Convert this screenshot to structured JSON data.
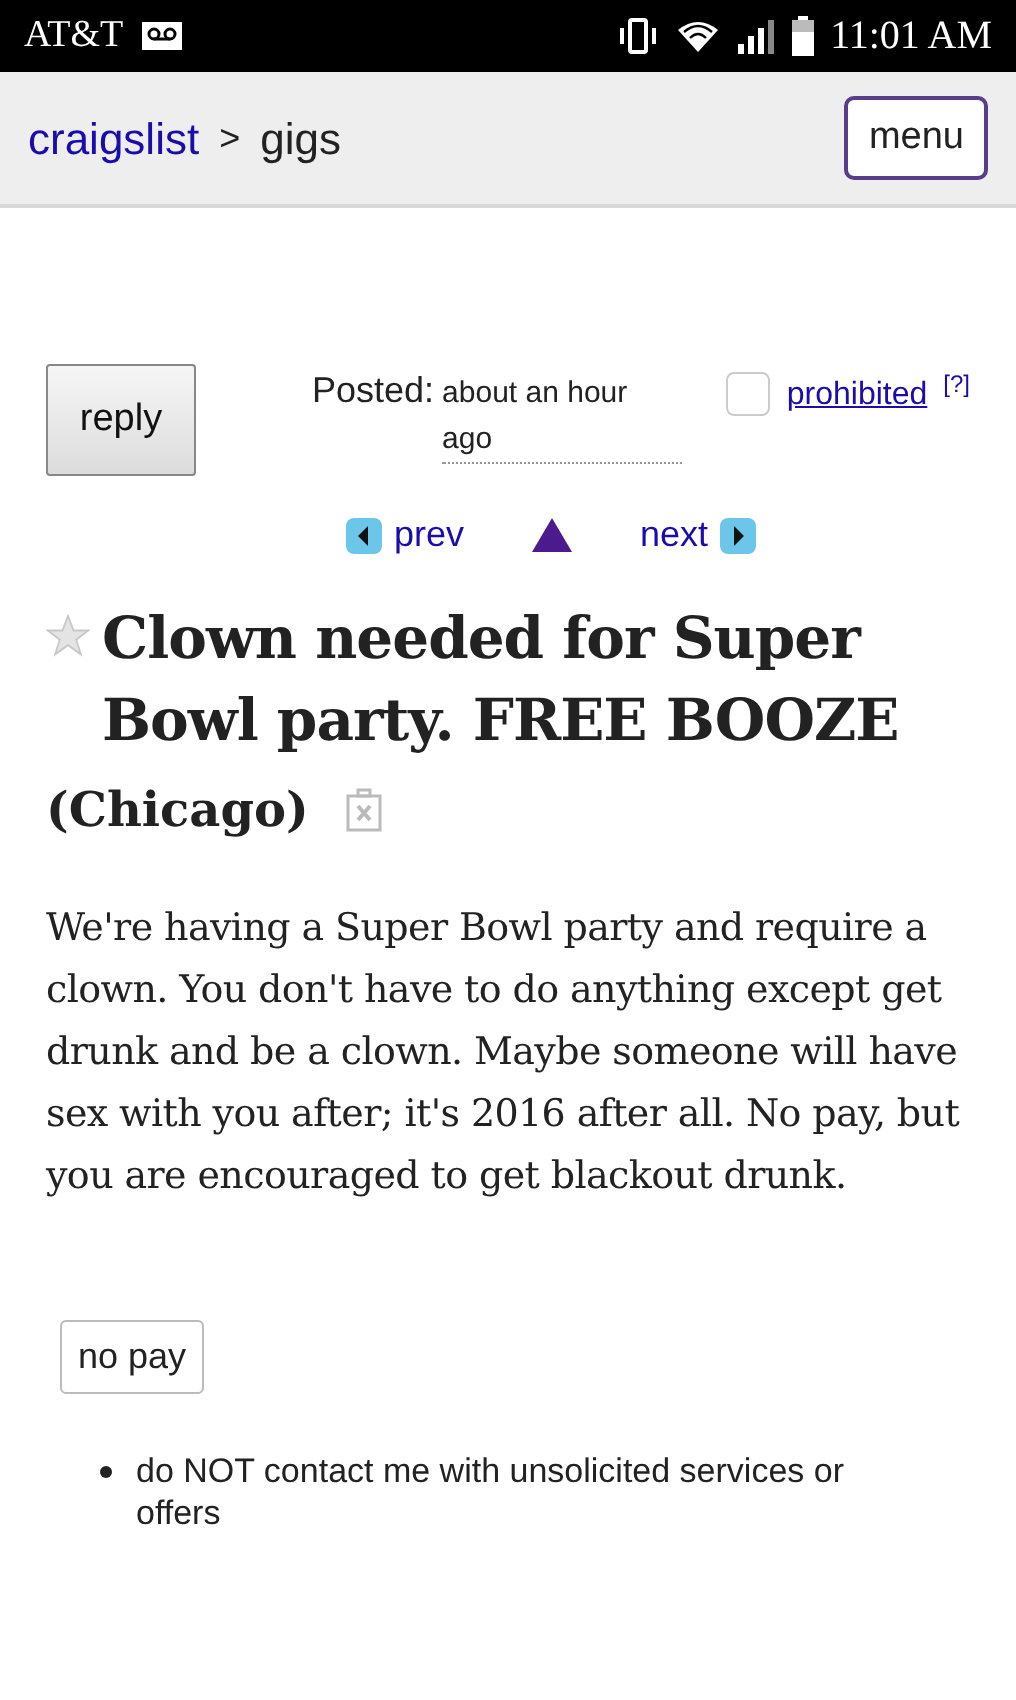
{
  "status_bar": {
    "carrier": "AT&T",
    "time": "11:01 AM"
  },
  "header": {
    "breadcrumb": [
      {
        "label": "craigslist",
        "kind": "link"
      },
      {
        "label": ">",
        "kind": "separator"
      },
      {
        "label": "gigs",
        "kind": "text"
      }
    ],
    "menu_button": "menu"
  },
  "actions": {
    "reply_button": "reply",
    "posted_label": "Posted:",
    "posted_time": "about an hour ago",
    "prohibited": {
      "label": "prohibited",
      "checked": false,
      "help": "[?]"
    }
  },
  "nav": {
    "prev": "prev",
    "next": "next"
  },
  "post": {
    "favorite": false,
    "title": "Clown needed for Super Bowl party. FREE BOOZE",
    "location": "(Chicago)",
    "body": "We're having a Super Bowl party and require a clown. You don't have to do anything except get drunk and be a clown. Maybe someone will have sex with you after; it's 2016 after all. No pay, but you are encouraged to get blackout drunk."
  },
  "compensation": "no pay",
  "notices": [
    "do NOT contact me with unsolicited services or offers"
  ]
}
